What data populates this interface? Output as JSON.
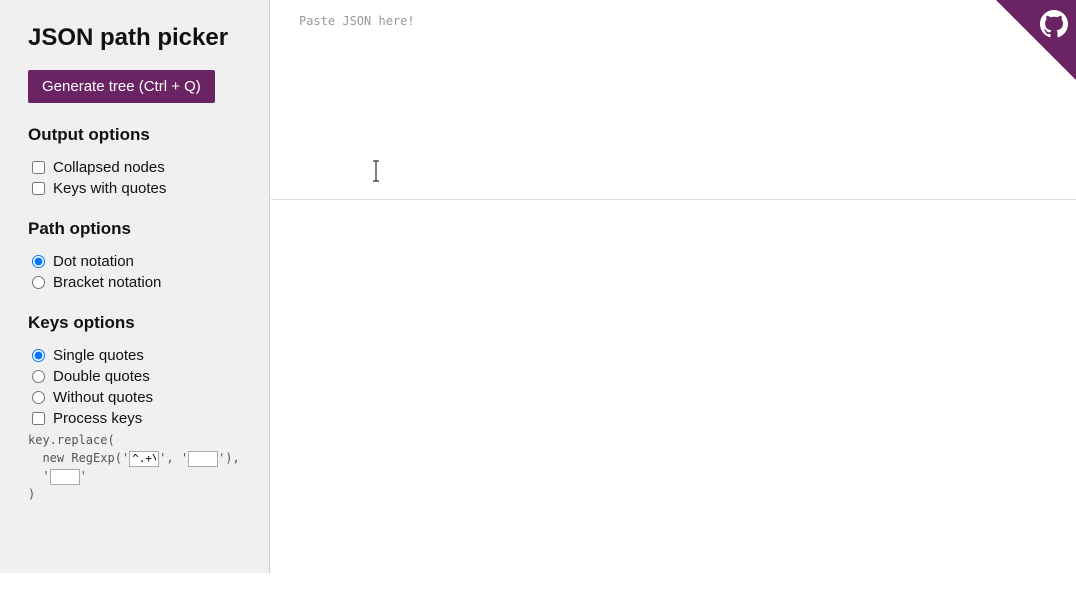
{
  "app": {
    "title": "JSON path picker",
    "generate_button": "Generate tree (Ctrl + Q)"
  },
  "sections": {
    "output": {
      "heading": "Output options",
      "collapsed_label": "Collapsed nodes",
      "keys_quotes_label": "Keys with quotes"
    },
    "path": {
      "heading": "Path options",
      "dot_label": "Dot notation",
      "bracket_label": "Bracket notation"
    },
    "keys": {
      "heading": "Keys options",
      "single_label": "Single quotes",
      "double_label": "Double quotes",
      "without_label": "Without quotes",
      "process_label": "Process keys",
      "code_line1": "key.replace(",
      "code_line2a": "  new RegExp('",
      "regex_default": "^.+\\.",
      "code_line2b": "', '",
      "flags_default": "",
      "code_line2c": "'),",
      "code_line3a": "  '",
      "replace_default": "",
      "code_line3b": "'",
      "code_line4": ")"
    }
  },
  "editor": {
    "placeholder": "Paste JSON here!"
  },
  "colors": {
    "accent": "#6b2463"
  }
}
